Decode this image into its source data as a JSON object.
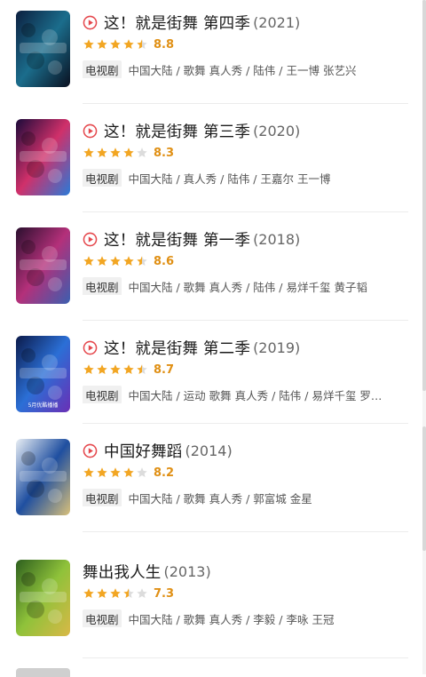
{
  "theme": {
    "star_color": "#f2a623",
    "star_empty_color": "#dcdcdc",
    "play_color": "#e5484d",
    "score_color": "#e09015"
  },
  "results": [
    {
      "title": "这！就是街舞 第四季",
      "year": "(2021)",
      "score": "8.8",
      "stars": 4.5,
      "playable": true,
      "type": "电视剧",
      "meta": "中国大陆 / 歌舞 真人秀 / 陆伟 / 王一博 张艺兴",
      "poster_colors": [
        "#0c1f3f",
        "#1b6d8c",
        "#0a1020"
      ]
    },
    {
      "title": "这！就是街舞 第三季",
      "year": "(2020)",
      "score": "8.3",
      "stars": 4,
      "playable": true,
      "type": "电视剧",
      "meta": "中国大陆 / 真人秀 / 陆伟 / 王嘉尔 王一博",
      "poster_colors": [
        "#1c0a3a",
        "#d0306a",
        "#2a7ad8"
      ]
    },
    {
      "title": "这！就是街舞 第一季",
      "year": "(2018)",
      "score": "8.6",
      "stars": 4.5,
      "playable": true,
      "type": "电视剧",
      "meta": "中国大陆 / 歌舞 真人秀 / 陆伟 / 易烊千玺 黄子韬",
      "poster_colors": [
        "#2a0f2e",
        "#b4307a",
        "#3b5fb0"
      ]
    },
    {
      "title": "这！就是街舞 第二季",
      "year": "(2019)",
      "score": "8.7",
      "stars": 4.5,
      "playable": true,
      "type": "电视剧",
      "meta": "中国大陆 / 运动 歌舞 真人秀 / 陆伟 / 易烊千玺 罗…",
      "poster_colors": [
        "#0b1a4a",
        "#2b6fd6",
        "#6a2fb5"
      ],
      "poster_text": "5月优酷播播"
    },
    {
      "title": "中国好舞蹈",
      "year": "(2014)",
      "score": "8.2",
      "stars": 4,
      "playable": true,
      "type": "电视剧",
      "meta": "中国大陆 / 歌舞 真人秀 / 郭富城 金星",
      "poster_colors": [
        "#e8eef4",
        "#1f4fa0",
        "#d8c07a"
      ]
    },
    {
      "title": "舞出我人生",
      "year": "(2013)",
      "score": "7.3",
      "stars": 3.5,
      "playable": false,
      "type": "电视剧",
      "meta": "中国大陆 / 歌舞 真人秀 / 李毅 / 李咏 王冠",
      "poster_colors": [
        "#2d5f1e",
        "#8fc23a",
        "#d9b847"
      ]
    }
  ]
}
